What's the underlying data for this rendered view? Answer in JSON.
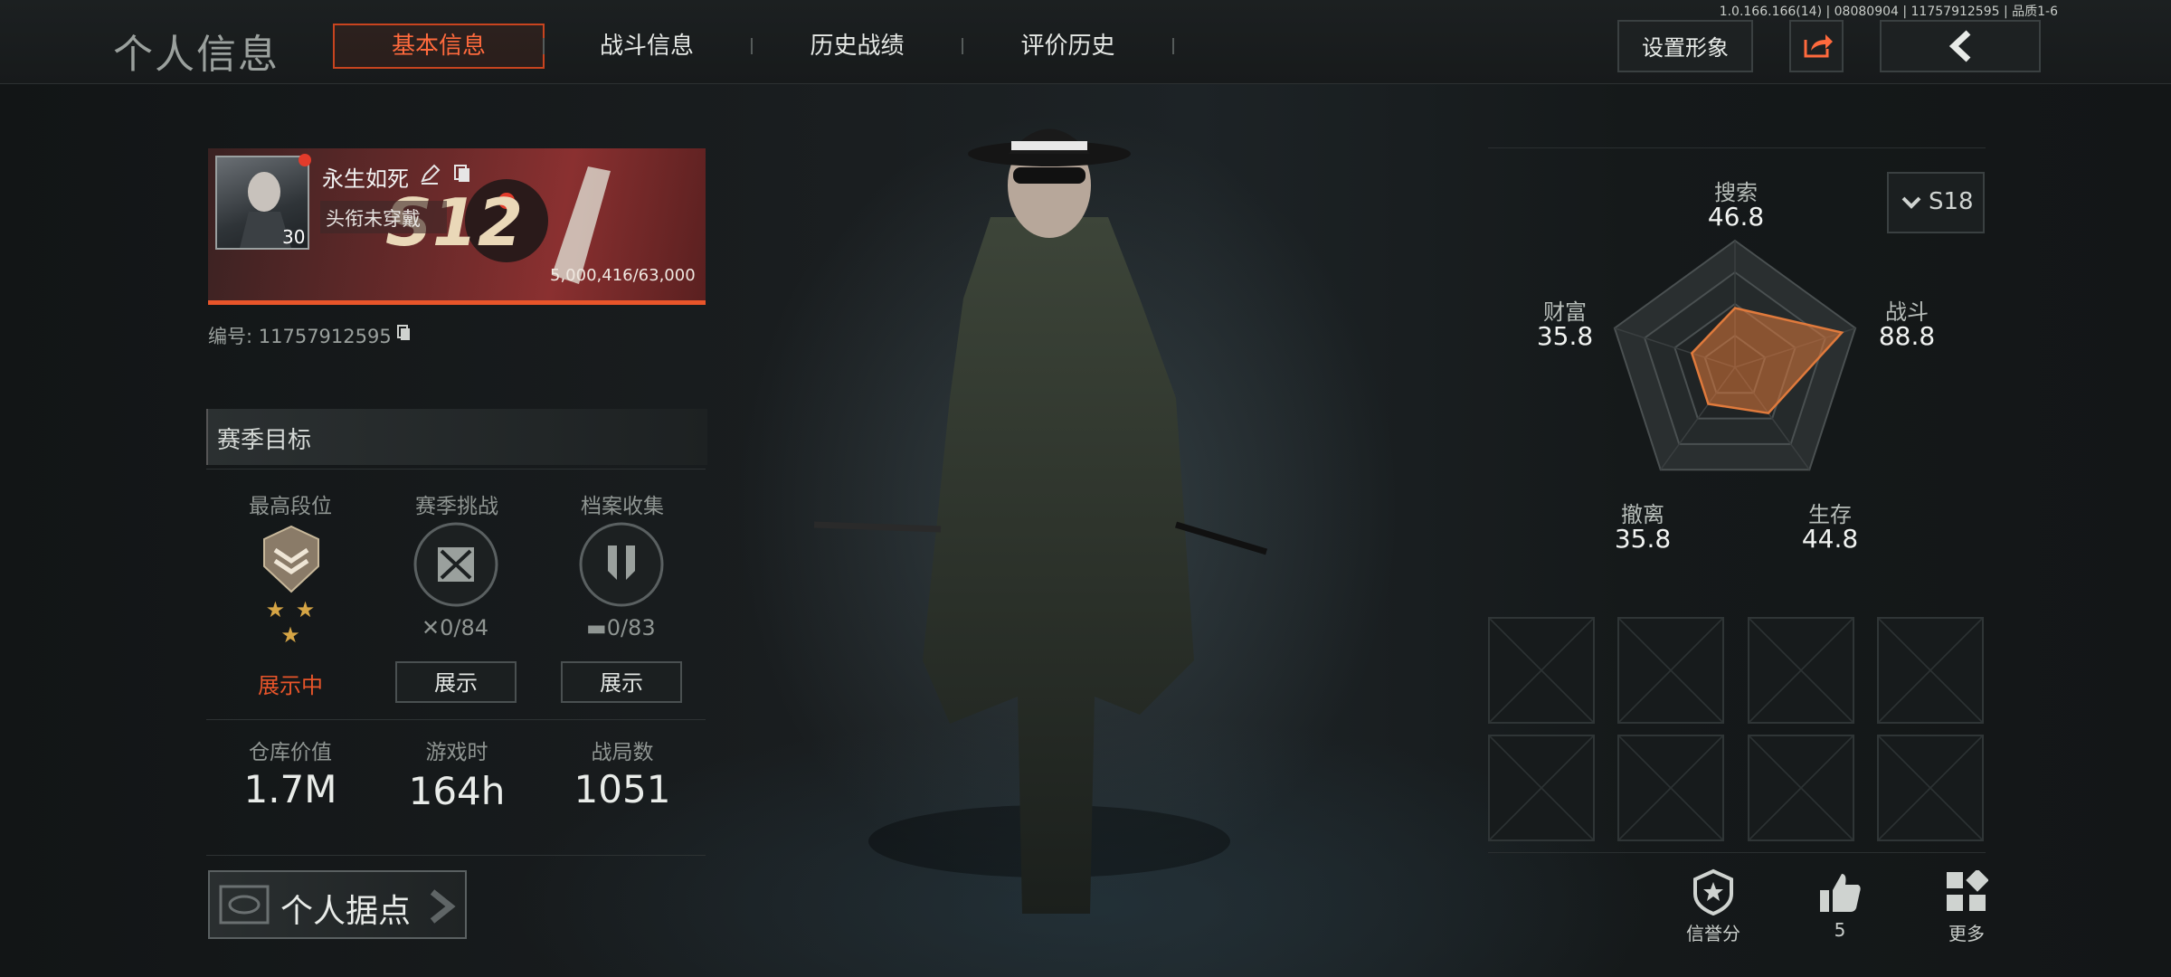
{
  "version": "1.0.166.166(14) | 08080904 | 11757912595 | 品质1-6",
  "header": {
    "title": "个人信息",
    "tabs": [
      {
        "label": "基本信息",
        "active": true
      },
      {
        "label": "战斗信息",
        "active": false
      },
      {
        "label": "历史战绩",
        "active": false
      },
      {
        "label": "评价历史",
        "active": false
      }
    ],
    "set_appearance_label": "设置形象",
    "icons": {
      "share": "share-icon",
      "back": "back-chevron-icon"
    }
  },
  "profile": {
    "name": "永生如死",
    "title": "头衔未穿戴",
    "level": "30",
    "season_badge": "S12",
    "progress": "5,000,416/63,000",
    "id_label": "编号: 11757912595"
  },
  "season_goals": {
    "header": "赛季目标",
    "items": [
      {
        "label": "最高段位",
        "sub": "★ ★ ★",
        "status": "展示中",
        "icon": "rank-emblem-icon"
      },
      {
        "label": "赛季挑战",
        "sub": "0/84",
        "button": "展示",
        "icon": "crossed-swords-icon"
      },
      {
        "label": "档案收集",
        "sub": "0/83",
        "button": "展示",
        "icon": "files-icon"
      }
    ]
  },
  "stats": [
    {
      "label": "仓库价值",
      "value": "1.7M"
    },
    {
      "label": "游戏时",
      "value": "164h"
    },
    {
      "label": "战局数",
      "value": "1051"
    }
  ],
  "base_button": "个人据点",
  "radar": {
    "season": "S18",
    "axes": [
      {
        "label": "搜索",
        "value": "46.8"
      },
      {
        "label": "战斗",
        "value": "88.8"
      },
      {
        "label": "生存",
        "value": "44.8"
      },
      {
        "label": "撤离",
        "value": "35.8"
      },
      {
        "label": "财富",
        "value": "35.8"
      }
    ],
    "accent": "#e07a3c"
  },
  "footer": {
    "credit_label": "信誉分",
    "likes": "5",
    "more_label": "更多"
  }
}
